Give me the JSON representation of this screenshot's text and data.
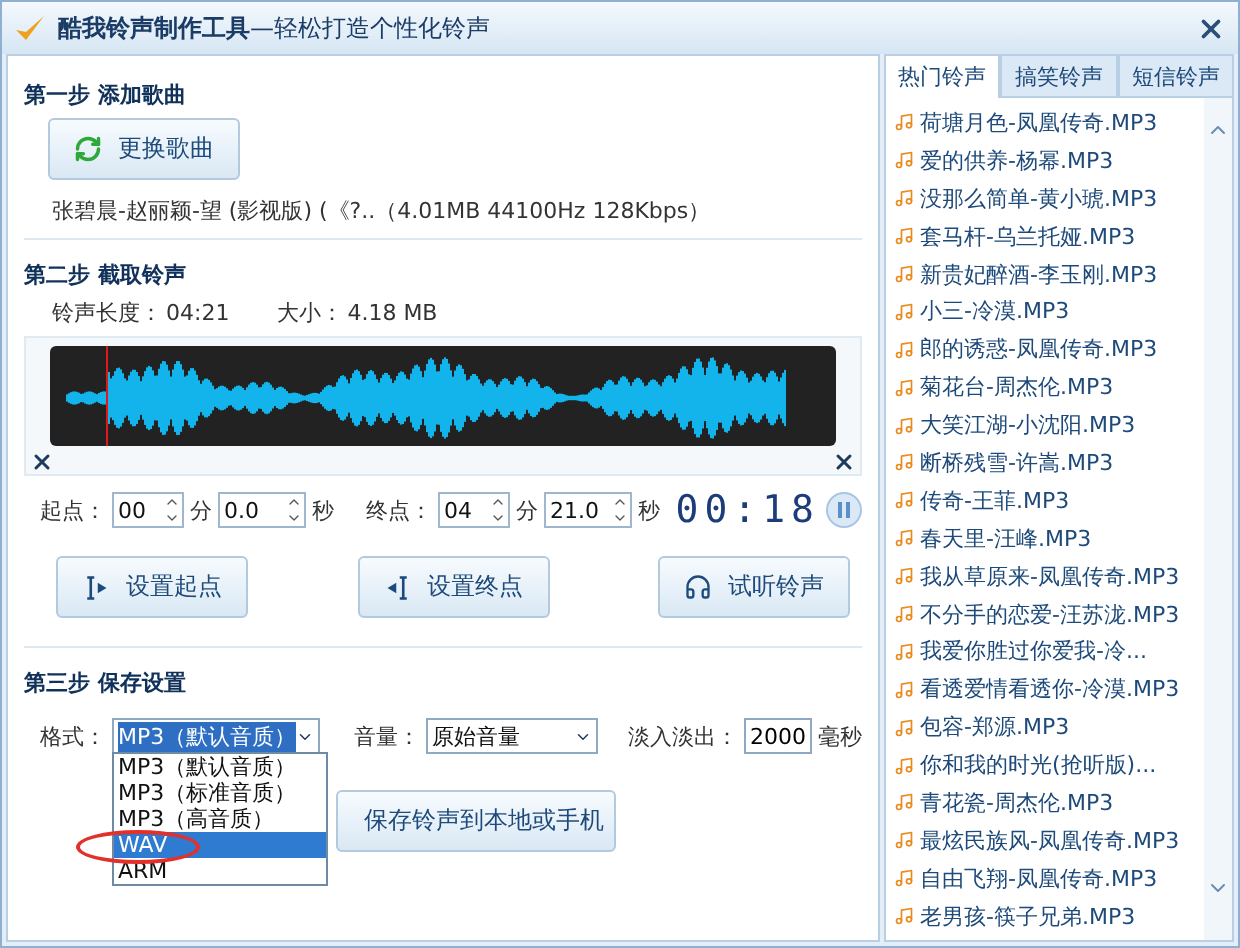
{
  "window": {
    "title": "**酷我铃声制作工具**—轻松打造个性化铃声"
  },
  "step1": {
    "heading": "第一步  添加歌曲",
    "button": "更换歌曲",
    "file_info": "张碧晨-赵丽颖-望 (影视版) (《?..（4.01MB 44100Hz  128Kbps）"
  },
  "step2": {
    "heading": "第二步  截取铃声",
    "length_label": "铃声长度：",
    "length": "04:21",
    "size_label": "大小：",
    "size": "4.18 MB",
    "playhead": {
      "level": 0.07
    },
    "start": {
      "label": "起点：",
      "min": "00",
      "min_unit": "分",
      "sec": "0.0",
      "sec_unit": "秒"
    },
    "end": {
      "label": "终点：",
      "min": "04",
      "min_unit": "分",
      "sec": "21.0",
      "sec_unit": "秒"
    },
    "timer": "00:18",
    "buttons": [
      {
        "kind": "start",
        "label": "设置起点"
      },
      {
        "kind": "end",
        "label": "设置终点"
      },
      {
        "kind": "listen",
        "label": "试听铃声"
      }
    ]
  },
  "step3": {
    "heading": "第三步  保存设置",
    "format_label": "格式：",
    "format": "MP3（默认音质）",
    "format_options": [
      {
        "label": "MP3（默认音质）",
        "selected": false
      },
      {
        "label": "MP3（标准音质）",
        "selected": false
      },
      {
        "label": "MP3（高音质）",
        "selected": false
      },
      {
        "label": "WAV",
        "selected": true
      },
      {
        "label": "ARM",
        "selected": false
      }
    ],
    "volume_label": "音量：",
    "volume": "原始音量",
    "fade_label": "淡入淡出：",
    "fade": "2000",
    "fade_unit": "毫秒",
    "save_button": "保存铃声到本地或手机"
  },
  "sidebar": {
    "tabs": [
      {
        "label": "热门铃声",
        "selected": true
      },
      {
        "label": "搞笑铃声",
        "selected": false
      },
      {
        "label": "短信铃声",
        "selected": false
      }
    ],
    "items": [
      "荷塘月色-凤凰传奇.MP3",
      "爱的供养-杨幂.MP3",
      "没那么简单-黄小琥.MP3",
      "套马杆-乌兰托娅.MP3",
      "新贵妃醉酒-李玉刚.MP3",
      "小三-冷漠.MP3",
      "郎的诱惑-凤凰传奇.MP3",
      "菊花台-周杰伦.MP3",
      "大笑江湖-小沈阳.MP3",
      "断桥残雪-许嵩.MP3",
      "传奇-王菲.MP3",
      "春天里-汪峰.MP3",
      "我从草原来-凤凰传奇.MP3",
      "不分手的恋爱-汪苏泷.MP3",
      "我爱你胜过你爱我-冷...",
      "看透爱情看透你-冷漠.MP3",
      "包容-郑源.MP3",
      "你和我的时光(抢听版)...",
      "青花瓷-周杰伦.MP3",
      "最炫民族风-凤凰传奇.MP3",
      "自由飞翔-凤凰传奇.MP3",
      "老男孩-筷子兄弟.MP3"
    ]
  }
}
